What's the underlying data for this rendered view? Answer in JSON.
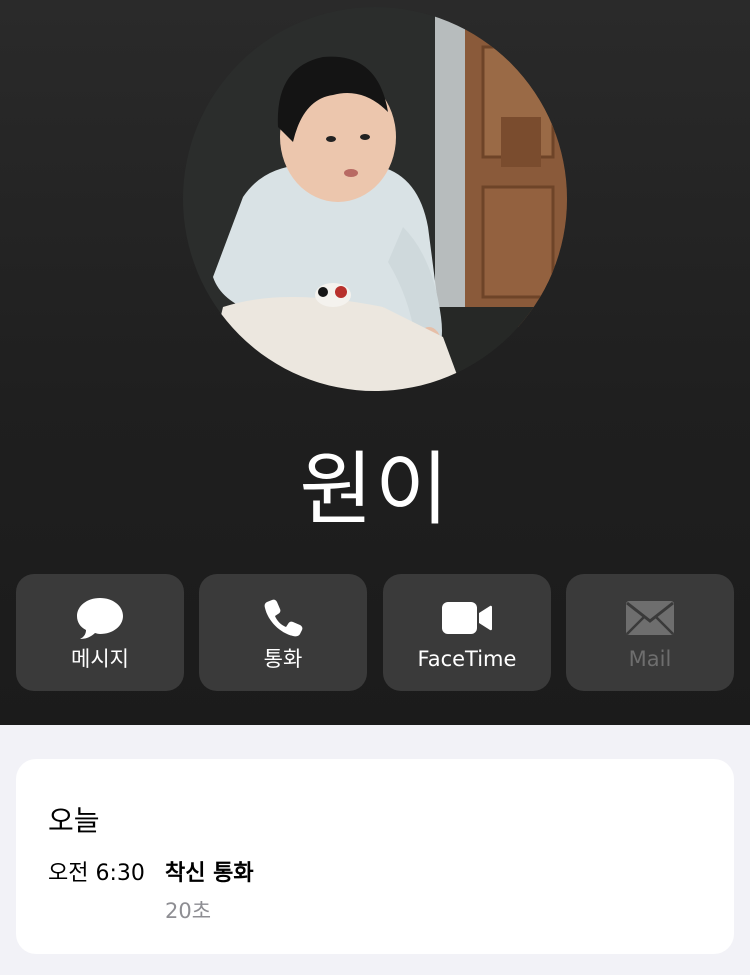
{
  "contact": {
    "name": "원이",
    "photo": "baby-portrait-photo"
  },
  "actions": [
    {
      "label": "메시지",
      "icon": "message-bubble-icon",
      "enabled": true
    },
    {
      "label": "통화",
      "icon": "phone-icon",
      "enabled": true
    },
    {
      "label": "FaceTime",
      "icon": "video-camera-icon",
      "enabled": true
    },
    {
      "label": "Mail",
      "icon": "mail-envelope-icon",
      "enabled": false
    }
  ],
  "call_history": {
    "day": "오늘",
    "entries": [
      {
        "time": "오전 6:30",
        "type": "착신 통화",
        "duration": "20초"
      }
    ]
  },
  "colors": {
    "header_bg": "#1f1f1f",
    "button_bg": "#3a3a3a",
    "disabled_text": "#6e6e6e",
    "page_bg": "#f2f2f7",
    "secondary_text": "#8e8e93"
  }
}
